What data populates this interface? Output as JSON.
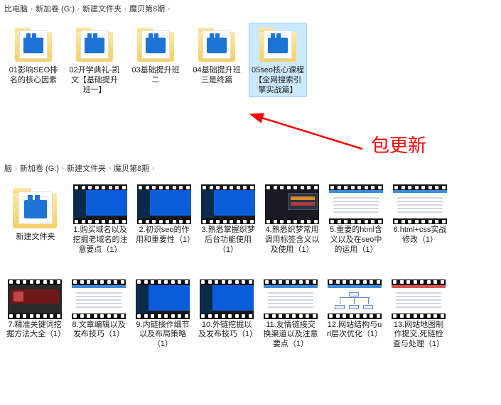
{
  "breadcrumb1": {
    "parts": [
      "比电脑",
      "新加卷 (G:)",
      "新建文件夹",
      "魔贝第8期"
    ]
  },
  "panel1": {
    "items": [
      {
        "kind": "folder",
        "label": "01影响SEO排名的核心因素"
      },
      {
        "kind": "folder",
        "label": "02开学典礼-凯文【基础提升班一】"
      },
      {
        "kind": "folder",
        "label": "03基础提升班二"
      },
      {
        "kind": "folder",
        "label": "04基础提升班三是终篇"
      },
      {
        "kind": "folder",
        "label": "05seo核心课程【全网搜索引擎实战篇】",
        "selected": true
      }
    ]
  },
  "annotation": {
    "text": "包更新",
    "color": "#ff0000"
  },
  "breadcrumb2": {
    "parts": [
      "脑",
      "新加卷 (G:)",
      "新建文件夹",
      "魔贝第8期"
    ]
  },
  "panel2": {
    "folder": {
      "label": "新建文件夹"
    },
    "videos_row1": [
      {
        "label": "1.购买域名以及挖掘老域名的注意要点（1）",
        "style": "desk"
      },
      {
        "label": "2.初识seo的作用和重要性（1）",
        "style": "desk"
      },
      {
        "label": "3.熟悉掌握织梦后台功能使用（1）",
        "style": "desk"
      },
      {
        "label": "4.熟悉织梦常用调用标签含义以及使用（1）",
        "style": "darkwin"
      },
      {
        "label": "5.重要的html含义以及在seo中的运用（1）",
        "style": "doc"
      },
      {
        "label": "6.html+css实战修改（1）",
        "style": "doc"
      }
    ],
    "videos_row2": [
      {
        "label": "7.精准关键词挖掘方法大全（1）",
        "style": "bdark"
      },
      {
        "label": "8.文章编辑以及发布技巧（1）",
        "style": "doc"
      },
      {
        "label": "9.内链操作细节以及布局策略（1）",
        "style": "desk"
      },
      {
        "label": "10.外链挖掘以及发布技巧（1）",
        "style": "desk"
      },
      {
        "label": "11.友情链接交换渠道以及注意要点（1）",
        "style": "doc"
      },
      {
        "label": "12.网站结构与url层次优化（1）",
        "style": "sitemap"
      },
      {
        "label": "13.网站地图制作提交,死链检查与处理（1）",
        "style": "docred"
      }
    ]
  }
}
